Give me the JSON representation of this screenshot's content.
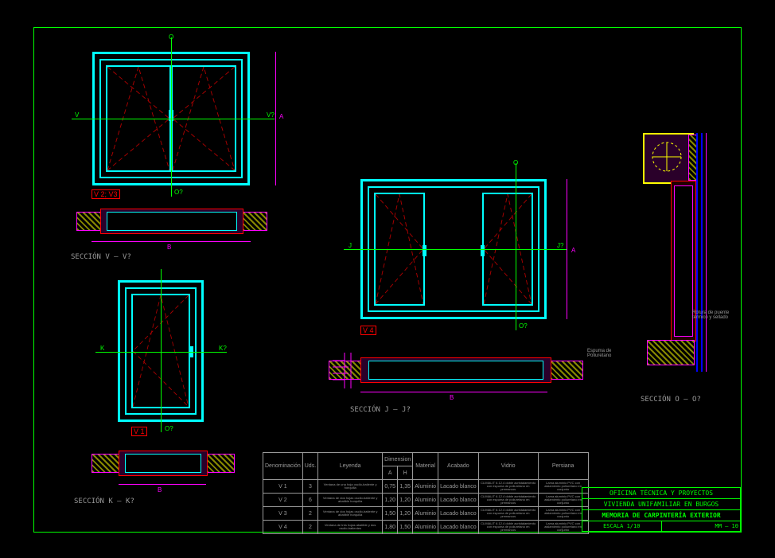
{
  "section_labels": {
    "vv": "SECCIÓN V — V?",
    "kk": "SECCIÓN K — K?",
    "jj": "SECCIÓN J — J?",
    "oo": "SECCIÓN O — O?"
  },
  "tags": {
    "v1": "V 1",
    "v23": "V 2; V3",
    "v4": "V 4"
  },
  "axis": {
    "v": "V",
    "v2": "V?",
    "k": "K",
    "k2": "K?",
    "j": "J",
    "j2": "J?",
    "o": "O",
    "o2": "O?",
    "a": "A",
    "b": "B"
  },
  "notes": {
    "espuma": "Espuma de\nPoliuretano",
    "rotura": "Rotura de puente\ntérmico y sellado"
  },
  "schedule": {
    "headers": [
      "Denominación",
      "Uds.",
      "Leyenda",
      "Dimension",
      "",
      "Material",
      "Acabado",
      "Vidrio",
      "Persiana"
    ],
    "subheaders": [
      "",
      "",
      "",
      "A",
      "H",
      "",
      "",
      "",
      ""
    ],
    "rows": [
      {
        "den": "V 1",
        "uds": "3",
        "ley": "Ventana de una hoja oscilo-batiente y horquilla",
        "a": "0,75",
        "h": "1,35",
        "mat": "Aluminio",
        "acab": "Lacado blanco",
        "vidrio": "CLIMALIT 6.12.4 doble acristalamiento con espuma de poliuretano en premarcos",
        "pers": "Lama aluminio PVC con aislamiento poliuretano en conjunto"
      },
      {
        "den": "V 2",
        "uds": "6",
        "ley": "Ventana de dos hojas oscilo-batiente y abatible horquilla",
        "a": "1,20",
        "h": "1,20",
        "mat": "Aluminio",
        "acab": "Lacado blanco",
        "vidrio": "CLIMALIT 6.12.4 doble acristalamiento con espuma de poliuretano en premarcos",
        "pers": "Lama aluminio PVC con aislamiento poliuretano en conjunto"
      },
      {
        "den": "V 3",
        "uds": "2",
        "ley": "Ventana de dos hojas oscilo-batiente y abatible horquilla",
        "a": "1,50",
        "h": "1,20",
        "mat": "Aluminio",
        "acab": "Lacado blanco",
        "vidrio": "CLIMALIT 6.12.4 doble acristalamiento con espuma de poliuretano en premarcos",
        "pers": "Lama aluminio PVC con aislamiento poliuretano en conjunto"
      },
      {
        "den": "V 4",
        "uds": "2",
        "ley": "Ventana de tres hojas abatible y dos oscilo-batientes",
        "a": "1,80",
        "h": "1,50",
        "mat": "Aluminio",
        "acab": "Lacado blanco",
        "vidrio": "CLIMALIT 6.12.4 doble acristalamiento con espuma de poliuretano en premarcos",
        "pers": "Lama aluminio PVC con aislamiento poliuretano en conjunto"
      }
    ]
  },
  "titleblock": {
    "l1": "OFICINA TÉCNICA Y PROYECTOS",
    "l2": "VIVIENDA UNIFAMILIAR EN BURGOS",
    "l3": "MEMORIA DE CARPINTERÍA EXTERIOR",
    "scale": "ESCALA 1/10",
    "code": "MM – 10"
  }
}
